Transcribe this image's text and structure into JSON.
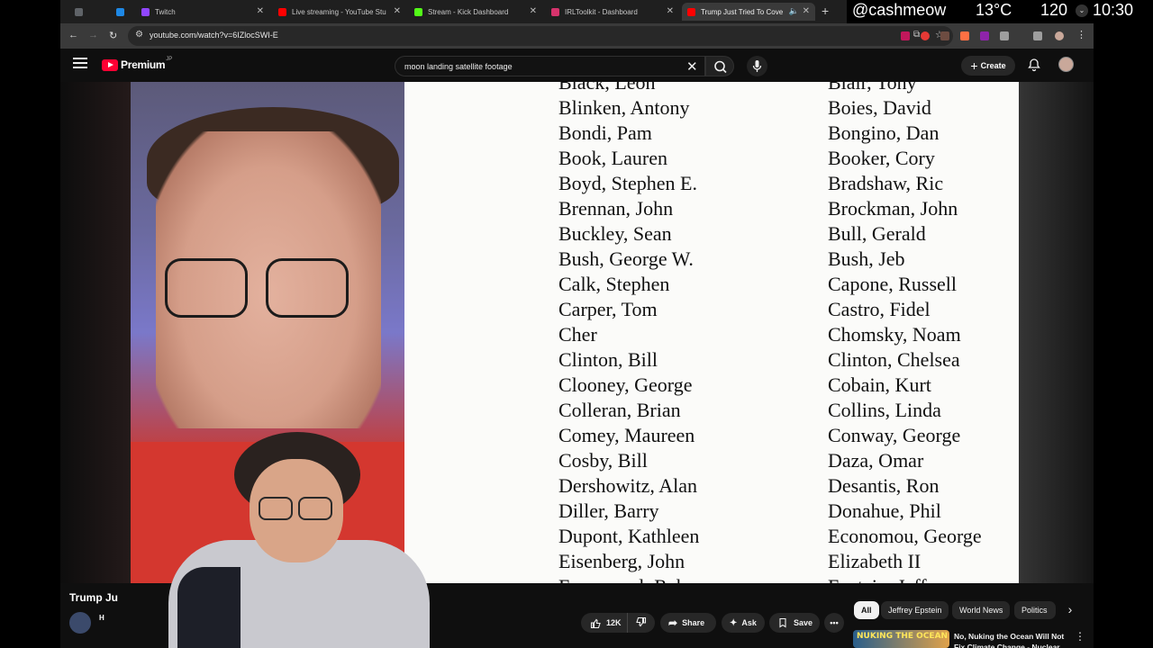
{
  "tabs": [
    {
      "title": "",
      "favicon_color": "#5f6368"
    },
    {
      "title": "",
      "favicon_color": "#1e88e5"
    },
    {
      "title": "Twitch",
      "favicon_color": "#9146ff"
    },
    {
      "title": "Live streaming - YouTube Stu",
      "favicon_color": "#ff0000"
    },
    {
      "title": "Stream - Kick Dashboard",
      "favicon_color": "#53fc18"
    },
    {
      "title": "IRLToolkit - Dashboard",
      "favicon_color": "#d6336c"
    },
    {
      "title": "Trump Just Tried To Cove",
      "favicon_color": "#ff0000"
    }
  ],
  "new_tab_label": "+",
  "address": {
    "url": "youtube.com/watch?v=6IZlocSWI-E"
  },
  "youtube": {
    "brand": "Premium",
    "brand_region": "JP",
    "search_query": "moon landing satellite footage",
    "create_label": "Create"
  },
  "document_names": {
    "left": [
      "Black, Leon",
      "Blinken, Antony",
      "Bondi, Pam",
      "Book, Lauren",
      "Boyd, Stephen E.",
      "Brennan, John",
      "Buckley, Sean",
      "Bush, George W.",
      "Calk, Stephen",
      "Carper, Tom",
      "Cher",
      "Clinton, Bill",
      "Clooney, George",
      "Colleran, Brian",
      "Comey, Maureen",
      "Cosby, Bill",
      "Dershowitz, Alan",
      "Diller, Barry",
      "Dupont, Kathleen",
      "Eisenberg, John",
      "Emmanuel, Rahm"
    ],
    "right": [
      "Blair, Tony",
      "Boies, David",
      "Bongino, Dan",
      "Booker, Cory",
      "Bradshaw, Ric",
      "Brockman, John",
      "Bull, Gerald",
      "Bush, Jeb",
      "Capone, Russell",
      "Castro, Fidel",
      "Chomsky, Noam",
      "Clinton, Chelsea",
      "Cobain, Kurt",
      "Collins, Linda",
      "Conway, George",
      "Daza, Omar",
      "Desantis, Ron",
      "Donahue, Phil",
      "Economou, George",
      "Elizabeth II",
      "Epstein, Jeffrey"
    ]
  },
  "video": {
    "title": "Trump Ju",
    "channel_initial": "H",
    "like_count": "12K",
    "share_label": "Share",
    "ask_label": "Ask",
    "save_label": "Save",
    "more_label": "•••"
  },
  "chips": [
    "All",
    "Jeffrey Epstein",
    "World News",
    "Politics"
  ],
  "recommendation": {
    "thumb_text": "NUKING THE OCEAN",
    "title": "No, Nuking the Ocean Will Not Fix Climate Change - Nuclear"
  },
  "overlay": {
    "handle": "@cashmeow",
    "temperature": "13°C",
    "speed": "120",
    "time": "10:30"
  }
}
